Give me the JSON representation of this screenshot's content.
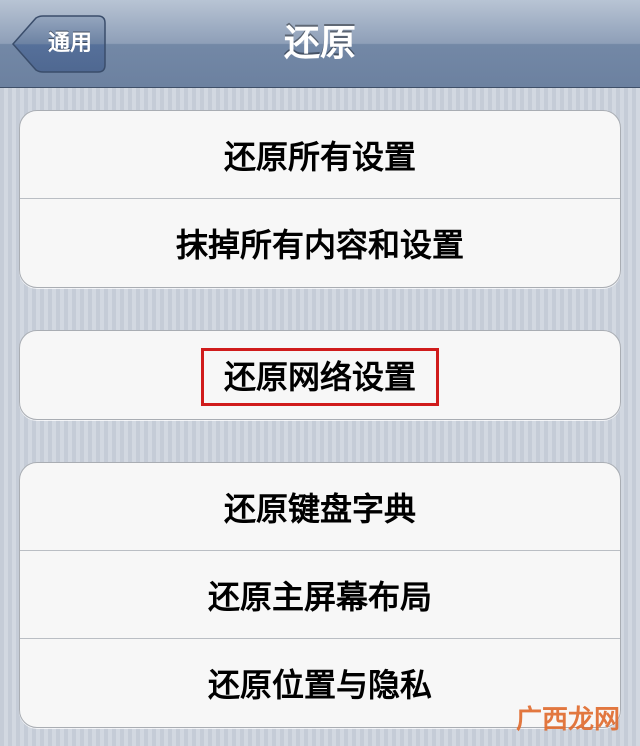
{
  "navbar": {
    "back_label": "通用",
    "title": "还原"
  },
  "groups": [
    {
      "items": [
        {
          "label": "还原所有设置"
        },
        {
          "label": "抹掉所有内容和设置"
        }
      ]
    },
    {
      "items": [
        {
          "label": "还原网络设置",
          "highlighted": true
        }
      ]
    },
    {
      "items": [
        {
          "label": "还原键盘字典"
        },
        {
          "label": "还原主屏幕布局"
        },
        {
          "label": "还原位置与隐私"
        }
      ]
    }
  ],
  "watermark": "广西龙网",
  "colors": {
    "highlight_box": "#d01c1c",
    "navbar_bottom": "#6c81a0"
  }
}
